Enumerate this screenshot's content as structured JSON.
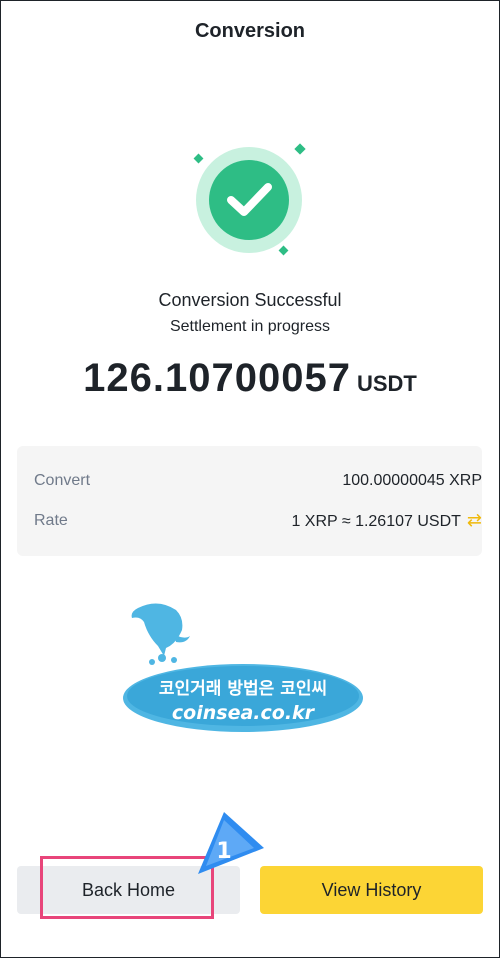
{
  "header": {
    "title": "Conversion"
  },
  "status": {
    "heading": "Conversion Successful",
    "subheading": "Settlement in progress"
  },
  "result": {
    "amount": "126.10700057",
    "unit": "USDT"
  },
  "details": [
    {
      "label": "Convert",
      "value": "100.00000045 XRP"
    },
    {
      "label": "Rate",
      "value": "1 XRP ≈ 1.26107 USDT",
      "icon": "swap-icon"
    }
  ],
  "watermark": {
    "line1": "코인거래 방법은 코인씨",
    "line2": "coinsea.co.kr"
  },
  "buttons": {
    "back_home": "Back Home",
    "view_history": "View History"
  },
  "annotation": {
    "step": "1"
  },
  "colors": {
    "success_green": "#2ebd85",
    "accent_yellow": "#fcd535",
    "highlight_pink": "#e8457a",
    "pointer_blue": "#2f8cf0"
  }
}
